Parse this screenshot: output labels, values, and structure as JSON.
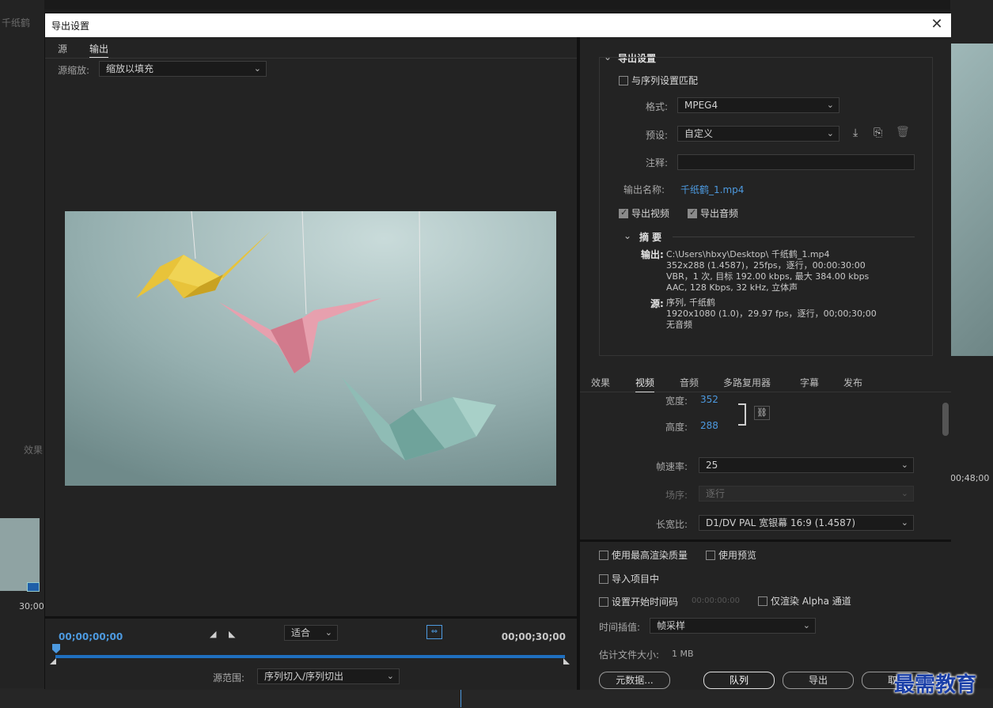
{
  "background": {
    "seq_title": "千纸鹤",
    "effects_label": "效果",
    "tc_left": "30;00",
    "tc_right": "00;48;00"
  },
  "dialog": {
    "title": "导出设置",
    "close_icon": "close-icon"
  },
  "left": {
    "tabs": [
      "源",
      "输出"
    ],
    "scale_label": "源缩放:",
    "scale_value": "缩放以填充",
    "tc_start": "00;00;00;00",
    "tc_end": "00;00;30;00",
    "fit_value": "适合",
    "range_label": "源范围:",
    "range_value": "序列切入/序列切出"
  },
  "export_settings": {
    "section_title": "导出设置",
    "match_seq": "与序列设置匹配",
    "format_label": "格式:",
    "format_value": "MPEG4",
    "preset_label": "预设:",
    "preset_value": "自定义",
    "comment_label": "注释:",
    "output_name_label": "输出名称:",
    "output_name_value": "千纸鹤_1.mp4",
    "export_video": "导出视频",
    "export_audio": "导出音频",
    "summary_title": "摘 要",
    "output_label": "输出:",
    "output_lines": [
      "C:\\Users\\hbxy\\Desktop\\ 千纸鹤_1.mp4",
      "352x288 (1.4587)，25fps，逐行，00:00:30:00",
      "VBR，1 次, 目标 192.00 kbps, 最大 384.00 kbps",
      "AAC, 128 Kbps, 32  kHz, 立体声"
    ],
    "source_label": "源:",
    "source_lines": [
      "序列, 千纸鹤",
      "1920x1080 (1.0)，29.97 fps，逐行，00;00;30;00",
      "无音频"
    ]
  },
  "tabs2": [
    "效果",
    "视频",
    "音频",
    "多路复用器",
    "字幕",
    "发布"
  ],
  "video": {
    "width_label": "宽度:",
    "width_value": "352",
    "height_label": "高度:",
    "height_value": "288",
    "fps_label": "帧速率:",
    "fps_value": "25",
    "field_label": "场序:",
    "field_value": "逐行",
    "aspect_label": "长宽比:",
    "aspect_value": "D1/DV PAL 宽银幕 16:9 (1.4587)"
  },
  "bottom": {
    "max_quality": "使用最高渲染质量",
    "use_preview": "使用预览",
    "import_project": "导入项目中",
    "set_start_tc": "设置开始时间码",
    "start_tc_value": "00:00:00:00",
    "alpha_only": "仅渲染 Alpha 通道",
    "interp_label": "时间插值:",
    "interp_value": "帧采样",
    "est_size_label": "估计文件大小:",
    "est_size_value": "1 MB",
    "metadata_btn": "元数据...",
    "queue_btn": "队列",
    "export_btn": "导出",
    "cancel_btn": "取消"
  },
  "watermark": "最需教育",
  "colors": {
    "accent": "#4d9ae0",
    "dialog_bg": "#232323"
  }
}
